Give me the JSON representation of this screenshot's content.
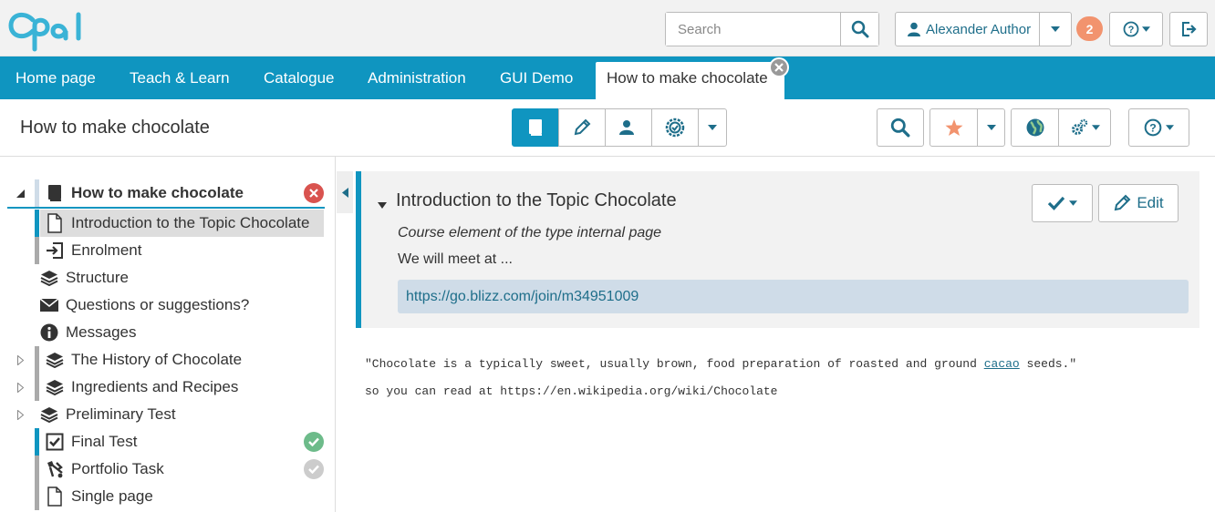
{
  "brand": {
    "logo_text": "opal",
    "accent": "#0f95c0",
    "logo_color": "#3ab3d6"
  },
  "header": {
    "search_placeholder": "Search",
    "user_name": "Alexander Author",
    "notification_count": "2"
  },
  "nav": {
    "items": [
      "Home page",
      "Teach & Learn",
      "Catalogue",
      "Administration",
      "GUI Demo"
    ],
    "active_tab": "How to make chocolate"
  },
  "toolbar": {
    "course_title": "How to make chocolate"
  },
  "tree": {
    "items": [
      {
        "label": "How to make chocolate",
        "icon": "book-icon"
      },
      {
        "label": "Introduction to the Topic Chocolate",
        "icon": "page-icon"
      },
      {
        "label": "Enrolment",
        "icon": "enrolment-icon"
      },
      {
        "label": "Structure",
        "icon": "layers-icon"
      },
      {
        "label": "Questions or suggestions?",
        "icon": "envelope-icon"
      },
      {
        "label": "Messages",
        "icon": "info-icon"
      },
      {
        "label": "The History of Chocolate",
        "icon": "layers-icon"
      },
      {
        "label": "Ingredients and Recipes",
        "icon": "layers-icon"
      },
      {
        "label": "Preliminary Test",
        "icon": "layers-icon"
      },
      {
        "label": "Final Test",
        "icon": "checkbox-icon"
      },
      {
        "label": "Portfolio Task",
        "icon": "portfolio-icon"
      },
      {
        "label": "Single page",
        "icon": "page-icon"
      }
    ]
  },
  "content": {
    "title": "Introduction to the Topic Chocolate",
    "subtitle": "Course element of the type internal page",
    "text": "We will meet at ...",
    "link": "https://go.blizz.com/join/m34951009",
    "edit_label": "Edit",
    "quote_before": "\"Chocolate is a typically sweet, usually brown, food preparation of roasted and ground ",
    "quote_link": "cacao",
    "quote_after": " seeds.\"",
    "read_line": "so you can read at https://en.wikipedia.org/wiki/Chocolate"
  }
}
